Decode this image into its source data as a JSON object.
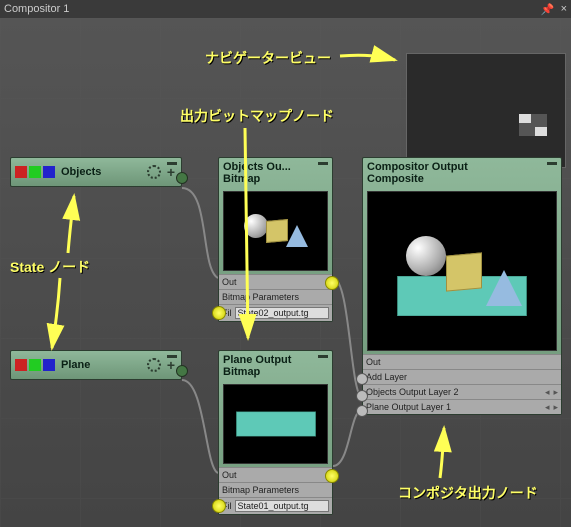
{
  "window": {
    "title": "Compositor 1",
    "pin": "📌",
    "close": "×"
  },
  "annotations": {
    "navigator_view": "ナビゲータービュー",
    "output_bitmap_node": "出力ビットマップノード",
    "state_node": "State ノード",
    "compositor_output_node": "コンポジタ出力ノード"
  },
  "nodes": {
    "state_objects": {
      "label": "Objects"
    },
    "state_plane": {
      "label": "Plane"
    },
    "objects_output": {
      "title_line1": "Objects Ou...",
      "title_line2": "Bitmap",
      "out": "Out",
      "bitmap_params": "Bitmap Parameters",
      "file_label": "Fil",
      "file_value": "State02_output.tg"
    },
    "plane_output": {
      "title_line1": "Plane Output",
      "title_line2": "Bitmap",
      "out": "Out",
      "bitmap_params": "Bitmap Parameters",
      "file_label": "Fil",
      "file_value": "State01_output.tg"
    },
    "compositor": {
      "title_line1": "Compositor Output",
      "title_line2": "Composite",
      "out": "Out",
      "add_layer": "Add Layer",
      "layer2": "Objects Output Layer 2",
      "layer1": "Plane Output Layer 1"
    }
  }
}
